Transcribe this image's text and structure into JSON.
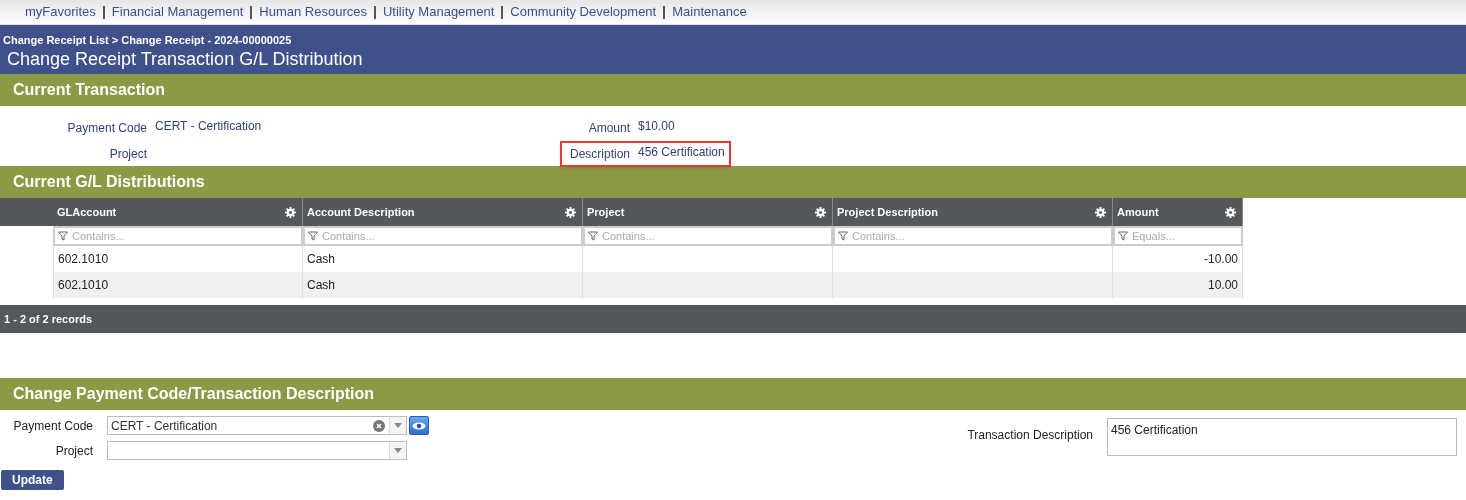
{
  "nav": [
    "myFavorites",
    "Financial Management",
    "Human Resources",
    "Utility Management",
    "Community Development",
    "Maintenance"
  ],
  "breadcrumb": "Change Receipt List > Change Receipt - 2024-00000025",
  "page_title": "Change Receipt Transaction G/L Distribution",
  "current_transaction": {
    "title": "Current Transaction",
    "left": [
      {
        "label": "Payment Code",
        "value": "CERT - Certification",
        "highlighted": false
      },
      {
        "label": "Project",
        "highlighted": false
      }
    ],
    "right": [
      {
        "label": "Amount",
        "value": "$10.00",
        "highlighted": false
      },
      {
        "label": "Description",
        "value": "456 Certification",
        "highlighted": true
      }
    ]
  },
  "distributions": {
    "title": "Current G/L Distributions",
    "columns": [
      {
        "label": "GLAccount",
        "placeholder": "Contains...",
        "kind": "text"
      },
      {
        "label": "Account Description",
        "placeholder": "Contains...",
        "kind": "text"
      },
      {
        "label": "Project",
        "placeholder": "Contains...",
        "kind": "text"
      },
      {
        "label": "Project Description",
        "placeholder": "Contains...",
        "kind": "text"
      },
      {
        "label": "Amount",
        "placeholder": "Equals...",
        "kind": "number"
      }
    ],
    "rows": [
      [
        "602.1010",
        "Cash",
        "",
        "",
        "-10.00"
      ],
      [
        "602.1010",
        "Cash",
        "",
        "",
        "10.00"
      ]
    ],
    "footer": "1 - 2 of 2 records"
  },
  "change_form": {
    "title": "Change Payment Code/Transaction Description",
    "payment_code": {
      "label": "Payment Code",
      "value": "CERT - Certification"
    },
    "project": {
      "label": "Project"
    },
    "transaction_description": {
      "label": "Transaction Description",
      "value": "456 Certification"
    },
    "button": "Update"
  }
}
